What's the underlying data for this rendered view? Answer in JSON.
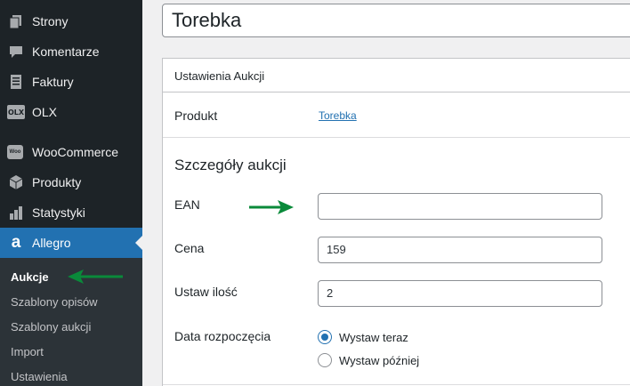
{
  "sidebar": {
    "items": [
      {
        "label": "Strony",
        "icon": "pages-icon"
      },
      {
        "label": "Komentarze",
        "icon": "comments-icon"
      },
      {
        "label": "Faktury",
        "icon": "invoice-icon"
      },
      {
        "label": "OLX",
        "icon": "olx-logo-icon"
      },
      {
        "label": "WooCommerce",
        "icon": "woocommerce-icon"
      },
      {
        "label": "Produkty",
        "icon": "products-box-icon"
      },
      {
        "label": "Statystyki",
        "icon": "bar-chart-icon"
      },
      {
        "label": "Allegro",
        "icon": "allegro-logo-icon"
      }
    ],
    "active_item": "Allegro",
    "submenu": [
      "Aukcje",
      "Szablony opisów",
      "Szablony aukcji",
      "Import",
      "Ustawienia"
    ],
    "current_submenu": "Aukcje",
    "olx_icon_text": "OLX",
    "woo_icon_text": "Woo",
    "allegro_icon_text": "a"
  },
  "title_value": "Torebka",
  "panel": {
    "title": "Ustawienia Aukcji",
    "product_label": "Produkt",
    "product_link": "Torebka",
    "section_title": "Szczegóły aukcji",
    "fields": {
      "ean": {
        "label": "EAN",
        "value": ""
      },
      "price": {
        "label": "Cena",
        "value": "159"
      },
      "quantity": {
        "label": "Ustaw ilość",
        "value": "2"
      }
    },
    "start_date": {
      "label": "Data rozpoczęcia",
      "options": [
        "Wystaw teraz",
        "Wystaw później"
      ],
      "selected": "Wystaw teraz"
    }
  },
  "colors": {
    "sidebar_bg": "#1d2327",
    "accent": "#2271b1",
    "arrow": "#0a8a3a"
  }
}
